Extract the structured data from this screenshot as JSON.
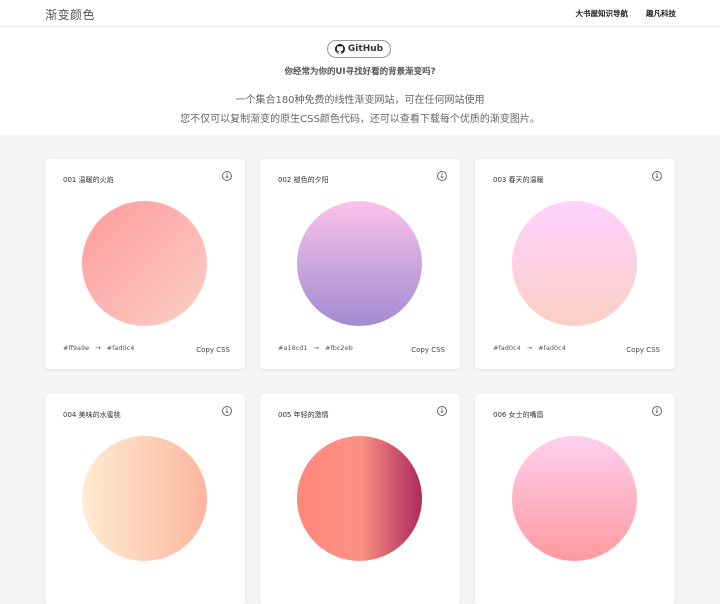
{
  "header": {
    "logo": "渐变颜色",
    "nav": [
      "大书屋知识导航",
      "趣凡科技"
    ]
  },
  "hero": {
    "github_label": "GitHub",
    "question": "你经常为你的UI寻找好看的背景渐变吗?",
    "desc_line1": "一个集合180种免费的线性渐变网站，可在任何网站使用",
    "desc_line2": "您不仅可以复制渐变的原生CSS颜色代码，还可以查看下载每个优质的渐变图片。"
  },
  "gradients": [
    {
      "title": "001 温暖的火焰",
      "from": "#ff9a9e",
      "to": "#fad0c4",
      "copy": "Copy CSS",
      "css": "linear-gradient(135deg, #ff9a9e 0%, #fad0c4 100%)"
    },
    {
      "title": "002 褪色的夕阳",
      "from": "#a18cd1",
      "to": "#fbc2eb",
      "copy": "Copy CSS",
      "css": "linear-gradient(0deg, #a18cd1 0%, #fbc2eb 100%)"
    },
    {
      "title": "003 春天的温暖",
      "from": "#fad0c4",
      "to": "#fad0c4",
      "copy": "Copy CSS",
      "css": "linear-gradient(0deg, #fad0c4 0%, #ffd1ff 100%)"
    },
    {
      "title": "004 美味的水蜜桃",
      "from": "",
      "to": "",
      "copy": "Copy CSS",
      "css": "linear-gradient(90deg, #ffecd2 0%, #fcb69f 100%)"
    },
    {
      "title": "005 年轻的激情",
      "from": "",
      "to": "",
      "copy": "Copy CSS",
      "css": "linear-gradient(90deg, #ff8177 0%, #ff867a 0%, #ff8c7f 21%, #f99185 52%, #cf556c 78%, #b12a5b 100%)"
    },
    {
      "title": "006 女士的嘴唇",
      "from": "",
      "to": "",
      "copy": "Copy CSS",
      "css": "linear-gradient(0deg, #ff9a9e 0%, #fecfef 99%, #fecfef 100%)"
    }
  ],
  "icons": {
    "github": "github-icon",
    "download": "download-icon"
  }
}
